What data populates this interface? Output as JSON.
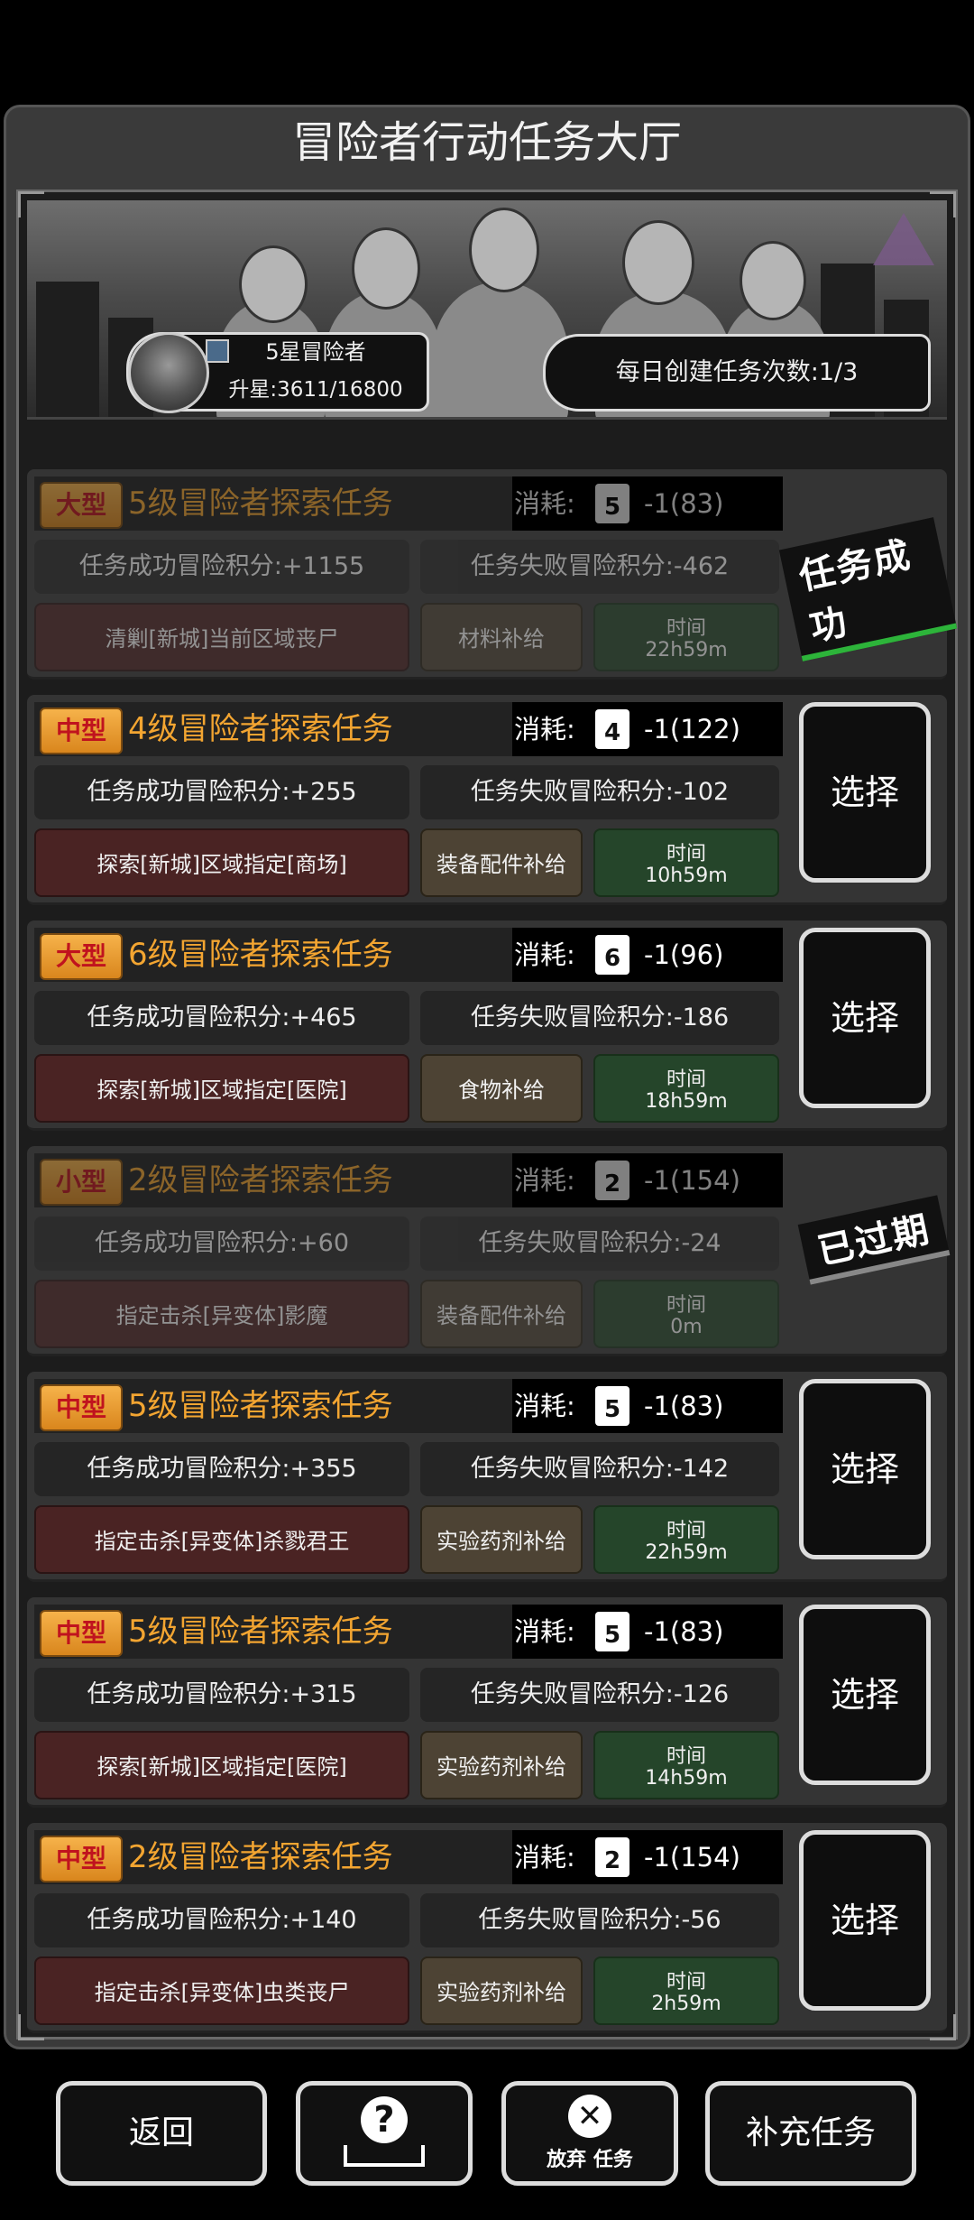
{
  "header": {
    "title": "冒险者行动任务大厅"
  },
  "player": {
    "rank": "5星冒险者",
    "progress": "升星:3611/16800"
  },
  "daily": {
    "label": "每日创建任务次数:1/3"
  },
  "tasks": [
    {
      "type": "大型",
      "title": "5级冒险者探索任务",
      "cost_label": "消耗:",
      "cost_level": "5",
      "cost_value": "-1(83)",
      "success": "任务成功冒险积分:+1155",
      "fail": "任务失败冒险积分:-462",
      "goal": "清剿[新城]当前区域丧尸",
      "supply": "材料补给",
      "time_label": "时间",
      "time_value": "22h59m",
      "status": "任务成功"
    },
    {
      "type": "中型",
      "title": "4级冒险者探索任务",
      "cost_label": "消耗:",
      "cost_level": "4",
      "cost_value": "-1(122)",
      "success": "任务成功冒险积分:+255",
      "fail": "任务失败冒险积分:-102",
      "goal": "探索[新城]区域指定[商场]",
      "supply": "装备配件补给",
      "time_label": "时间",
      "time_value": "10h59m",
      "button": "选择"
    },
    {
      "type": "大型",
      "title": "6级冒险者探索任务",
      "cost_label": "消耗:",
      "cost_level": "6",
      "cost_value": "-1(96)",
      "success": "任务成功冒险积分:+465",
      "fail": "任务失败冒险积分:-186",
      "goal": "探索[新城]区域指定[医院]",
      "supply": "食物补给",
      "time_label": "时间",
      "time_value": "18h59m",
      "button": "选择"
    },
    {
      "type": "小型",
      "title": "2级冒险者探索任务",
      "cost_label": "消耗:",
      "cost_level": "2",
      "cost_value": "-1(154)",
      "success": "任务成功冒险积分:+60",
      "fail": "任务失败冒险积分:-24",
      "goal": "指定击杀[异变体]影魔",
      "supply": "装备配件补给",
      "time_label": "时间",
      "time_value": "0m",
      "status": "已过期"
    },
    {
      "type": "中型",
      "title": "5级冒险者探索任务",
      "cost_label": "消耗:",
      "cost_level": "5",
      "cost_value": "-1(83)",
      "success": "任务成功冒险积分:+355",
      "fail": "任务失败冒险积分:-142",
      "goal": "指定击杀[异变体]杀戮君王",
      "supply": "实验药剂补给",
      "time_label": "时间",
      "time_value": "22h59m",
      "button": "选择"
    },
    {
      "type": "中型",
      "title": "5级冒险者探索任务",
      "cost_label": "消耗:",
      "cost_level": "5",
      "cost_value": "-1(83)",
      "success": "任务成功冒险积分:+315",
      "fail": "任务失败冒险积分:-126",
      "goal": "探索[新城]区域指定[医院]",
      "supply": "实验药剂补给",
      "time_label": "时间",
      "time_value": "14h59m",
      "button": "选择"
    },
    {
      "type": "中型",
      "title": "2级冒险者探索任务",
      "cost_label": "消耗:",
      "cost_level": "2",
      "cost_value": "-1(154)",
      "success": "任务成功冒险积分:+140",
      "fail": "任务失败冒险积分:-56",
      "goal": "指定击杀[异变体]虫类丧尸",
      "supply": "实验药剂补给",
      "time_label": "时间",
      "time_value": "2h59m",
      "button": "选择"
    }
  ],
  "footer": {
    "back": "返回",
    "abandon": "放弃 任务",
    "replenish": "补充任务"
  }
}
